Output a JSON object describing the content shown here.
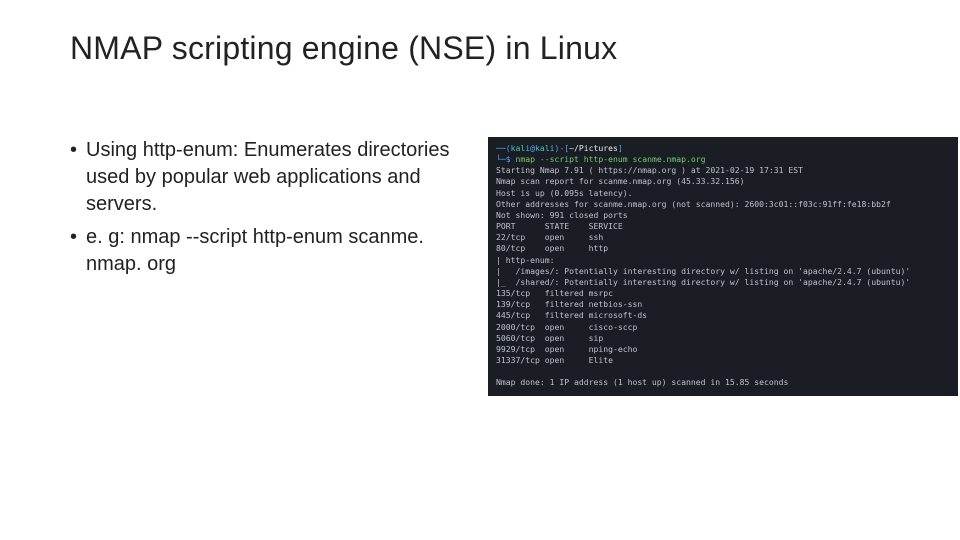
{
  "title": "NMAP scripting engine (NSE) in Linux",
  "bullets": [
    "Using http-enum: Enumerates directories used by popular web applications and servers.",
    "e. g: nmap --script http-enum scanme. nmap. org"
  ],
  "terminal": {
    "prompt_user": "kali",
    "prompt_at": "@",
    "prompt_host": "kali",
    "prompt_path": "~/Pictures",
    "prompt_cmd": "nmap --script http-enum scanme.nmap.org",
    "lines": {
      "starting": "Starting Nmap 7.91 ( https://nmap.org ) at 2021-02-19 17:31 EST",
      "report": "Nmap scan report for scanme.nmap.org (45.33.32.156)",
      "hostup": "Host is up (0.095s latency).",
      "other": "Other addresses for scanme.nmap.org (not scanned): 2600:3c01::f03c:91ff:fe18:bb2f",
      "notshown": "Not shown: 991 closed ports",
      "header": "PORT      STATE    SERVICE",
      "p22": "22/tcp    open     ssh",
      "p80": "80/tcp    open     http",
      "httpenum": "| http-enum:",
      "img": "|   /images/: Potentially interesting directory w/ listing on 'apache/2.4.7 (ubuntu)'",
      "shared": "|_  /shared/: Potentially interesting directory w/ listing on 'apache/2.4.7 (ubuntu)'",
      "p135": "135/tcp   filtered msrpc",
      "p139": "139/tcp   filtered netbios-ssn",
      "p445": "445/tcp   filtered microsoft-ds",
      "p2000": "2000/tcp  open     cisco-sccp",
      "p5060": "5060/tcp  open     sip",
      "p9929": "9929/tcp  open     nping-echo",
      "p31337": "31337/tcp open     Elite",
      "blank": "",
      "done": "Nmap done: 1 IP address (1 host up) scanned in 15.85 seconds"
    }
  }
}
